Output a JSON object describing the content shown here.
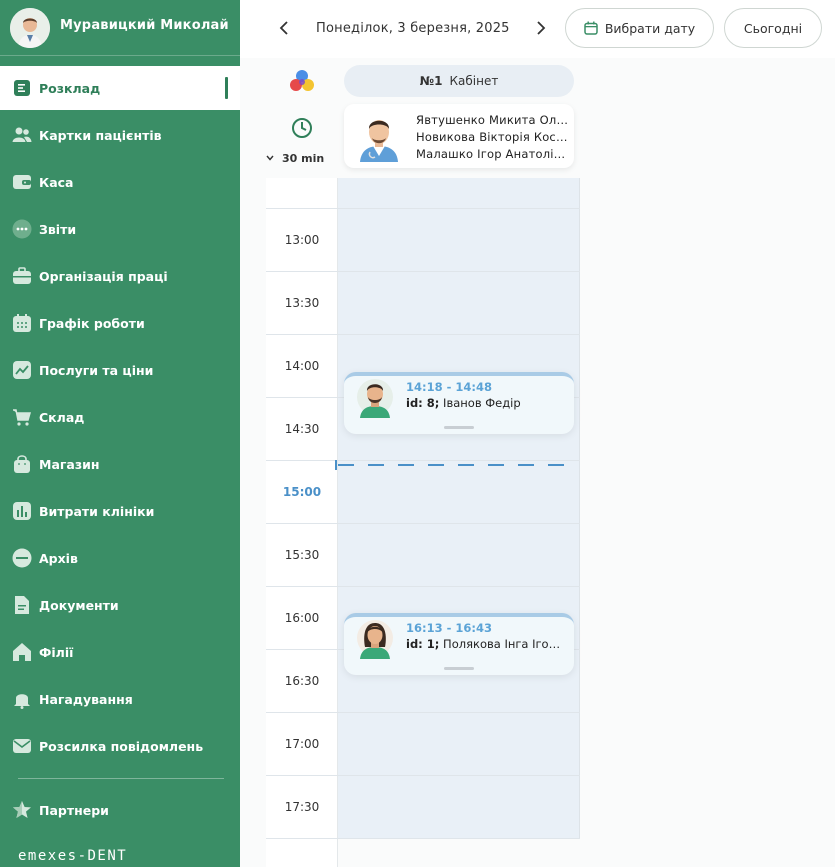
{
  "user": {
    "name": "Муравицкий Миколай"
  },
  "sidebar": {
    "items": [
      {
        "label": "Розклад",
        "icon": "schedule-icon"
      },
      {
        "label": "Картки пацієнтів",
        "icon": "patients-icon"
      },
      {
        "label": "Каса",
        "icon": "wallet-icon"
      },
      {
        "label": "Звіти",
        "icon": "dots-icon"
      },
      {
        "label": "Організація праці",
        "icon": "briefcase-icon"
      },
      {
        "label": "Графік роботи",
        "icon": "calendar-icon"
      },
      {
        "label": "Послуги та ціни",
        "icon": "chart-line-icon"
      },
      {
        "label": "Склад",
        "icon": "cart-icon"
      },
      {
        "label": "Магазин",
        "icon": "bag-icon"
      },
      {
        "label": "Витрати клініки",
        "icon": "bar-chart-icon"
      },
      {
        "label": "Архів",
        "icon": "archive-icon"
      },
      {
        "label": "Документи",
        "icon": "document-icon"
      },
      {
        "label": "Філії",
        "icon": "home-icon"
      },
      {
        "label": "Нагадування",
        "icon": "bell-icon"
      },
      {
        "label": "Розсилка повідомлень",
        "icon": "mail-icon"
      }
    ],
    "partners": {
      "label": "Партнери",
      "icon": "star-icon"
    },
    "logo": "emexes-DENT"
  },
  "header": {
    "date": "Понеділок, 3 березня, 2025",
    "pick_date": "Вибрати дату",
    "today": "Сьогодні"
  },
  "schedule": {
    "interval": "30 min",
    "cabinet_number": "№1",
    "cabinet_label": "Кабінет",
    "doctors": [
      "Явтушенко Микита Олександрович",
      "Новикова Вікторія Костянтинівна",
      "Малашко Ігор Анатолійович"
    ],
    "times": [
      "13:00",
      "13:30",
      "14:00",
      "14:30",
      "15:00",
      "15:30",
      "16:00",
      "16:30",
      "17:00",
      "17:30"
    ],
    "current_time": "15:00",
    "appointments": [
      {
        "time": "14:18 - 14:48",
        "id_label": "id: 8;",
        "patient": "Іванов Федір"
      },
      {
        "time": "16:13 - 16:43",
        "id_label": "id: 1;",
        "patient": "Полякова Інга Ігорівна"
      }
    ]
  },
  "colors": {
    "sidebar": "#3a8e66",
    "accent": "#4a90c8",
    "grid": "#e9f0f7"
  }
}
